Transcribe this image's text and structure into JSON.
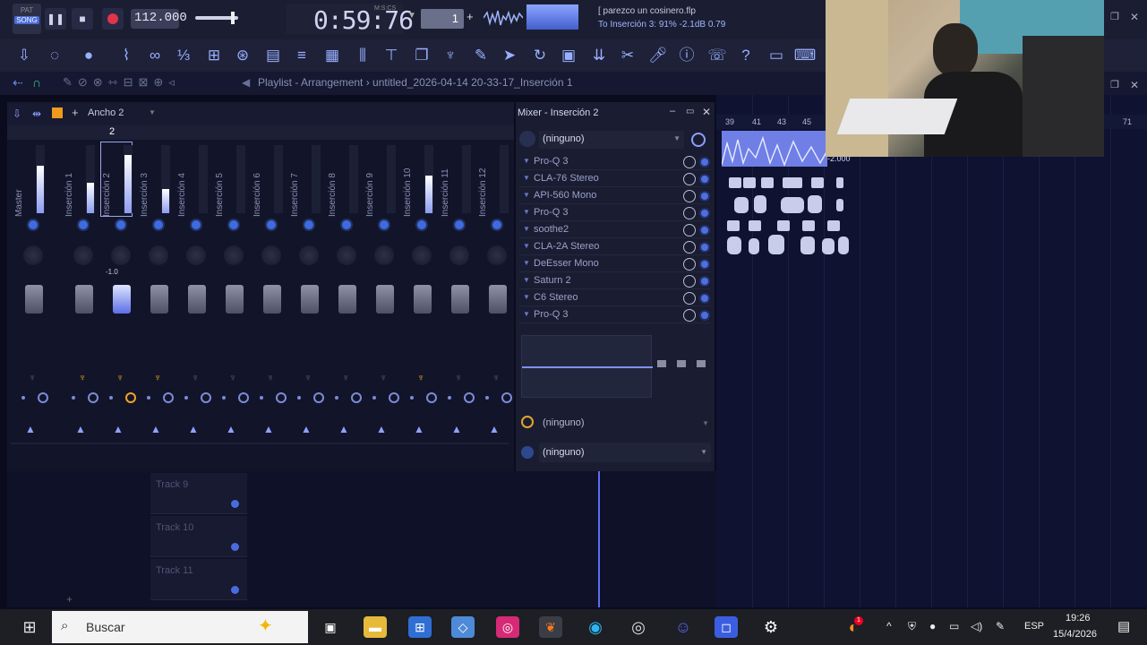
{
  "transport": {
    "mode_pat": "PAT",
    "mode_song": "SONG",
    "tempo": "112.000",
    "time": "0:59:76",
    "time_unit": "M:S:CS",
    "pattern_num": "1",
    "hint_line1": "[ parezco un cosinero.flp",
    "hint_line2": "To Inserción 3: 91%  -2.1dB  0.79"
  },
  "breadcrumb": "Playlist - Arrangement  ›  untitled_2026-04-14 20-33-17_Inserción 1",
  "mixer": {
    "width_label": "Ancho 2",
    "selected_index": "2",
    "fader_value": "-1.0",
    "strips": [
      {
        "label": "Master",
        "meter": 0.7,
        "route": "off"
      },
      {
        "label": "Inserción 1",
        "meter": 0.45,
        "route": "on"
      },
      {
        "label": "Inserción 2",
        "meter": 0.85,
        "route": "on"
      },
      {
        "label": "Inserción 3",
        "meter": 0.35,
        "route": "on"
      },
      {
        "label": "Inserción 4",
        "meter": 0.0,
        "route": "off"
      },
      {
        "label": "Inserción 5",
        "meter": 0.0,
        "route": "off"
      },
      {
        "label": "Inserción 6",
        "meter": 0.0,
        "route": "off"
      },
      {
        "label": "Inserción 7",
        "meter": 0.0,
        "route": "off"
      },
      {
        "label": "Inserción 8",
        "meter": 0.0,
        "route": "off"
      },
      {
        "label": "Inserción 9",
        "meter": 0.0,
        "route": "off"
      },
      {
        "label": "Inserción 10",
        "meter": 0.55,
        "route": "on"
      },
      {
        "label": "Inserción 11",
        "meter": 0.0,
        "route": "off"
      },
      {
        "label": "Inserción 12",
        "meter": 0.0,
        "route": "off"
      }
    ]
  },
  "insert_panel": {
    "title": "Mixer - Inserción 2",
    "input": "(ninguno)",
    "effects": [
      "Pro-Q 3",
      "CLA-76 Stereo",
      "API-560 Mono",
      "Pro-Q 3",
      "soothe2",
      "CLA-2A Stereo",
      "DeEsser Mono",
      "Saturn 2",
      "C6 Stereo",
      "Pro-Q 3"
    ],
    "out_top": "(ninguno)",
    "out_bottom": "(ninguno)"
  },
  "playlist": {
    "ruler": [
      "39",
      "41",
      "43",
      "45",
      "71"
    ],
    "tracks": [
      "Track 9",
      "Track 10",
      "Track 11"
    ],
    "clip_label": "-2.000"
  },
  "taskbar": {
    "search_placeholder": "Buscar",
    "lang": "ESP",
    "clock_time": "19:26",
    "clock_date": "15/4/2026",
    "notif_count": "1"
  },
  "colors": {
    "accent": "#4a6bd8",
    "record": "#e0344b",
    "route_on": "#f0a525"
  }
}
